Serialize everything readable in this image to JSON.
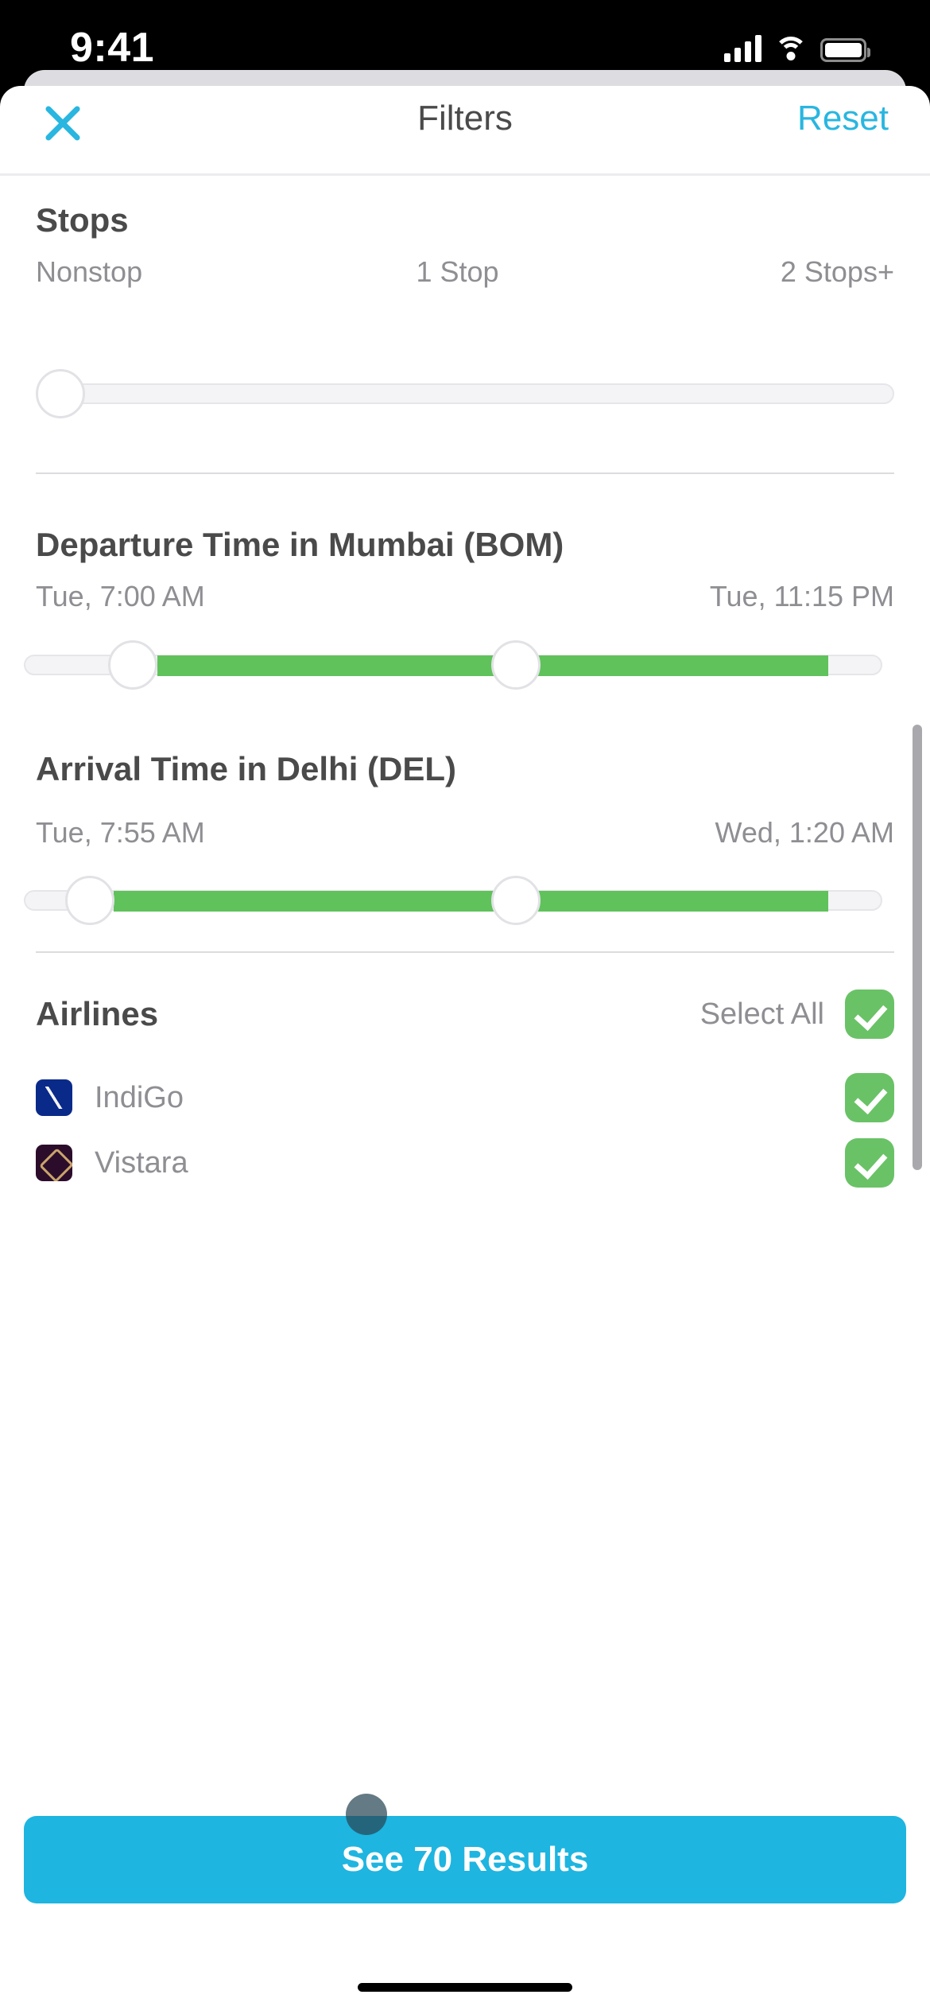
{
  "status_bar": {
    "time": "9:41",
    "signal_icon": "cellular-signal-icon",
    "wifi_icon": "wifi-icon",
    "battery_icon": "battery-icon"
  },
  "header": {
    "close_icon": "close-x-icon",
    "title": "Filters",
    "reset_label": "Reset"
  },
  "stops": {
    "title": "Stops",
    "labels": [
      "Nonstop",
      "1 Stop",
      "2 Stops+"
    ],
    "selected_index": 0,
    "knob_percent": 0
  },
  "departure": {
    "title": "Departure Time in Mumbai (BOM)",
    "min_label": "Tue, 7:00 AM",
    "max_label": "Tue, 11:15 PM",
    "low_percent": 13,
    "high_percent": 95
  },
  "arrival": {
    "title": "Arrival Time in Delhi (DEL)",
    "min_label": "Tue, 7:55 AM",
    "max_label": "Wed, 1:20 AM",
    "low_percent": 8,
    "high_percent": 95
  },
  "airlines": {
    "title": "Airlines",
    "select_all_label": "Select All",
    "select_all_checked": true,
    "items": [
      {
        "name": "IndiGo",
        "logo": "indigo-logo",
        "checked": true
      },
      {
        "name": "Vistara",
        "logo": "vistara-logo",
        "checked": true
      }
    ]
  },
  "cta": {
    "label": "See 70 Results",
    "results_count": 70
  },
  "colors": {
    "accent_cyan": "#1eb5e0",
    "slider_green": "#60c25b",
    "checkbox_green": "#6ac267",
    "text_dark": "#4a4a4a",
    "text_muted": "#8e8e93"
  }
}
